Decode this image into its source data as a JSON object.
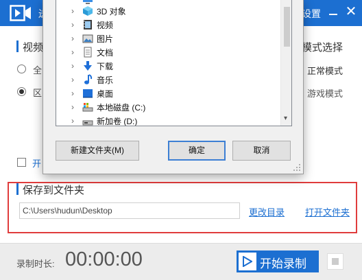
{
  "app": {
    "title_visible": "迸",
    "title_right": "设置",
    "colors": {
      "accent": "#1c6fd1",
      "highlight_border": "#e03c3c",
      "link": "#1c6fd1"
    }
  },
  "video_section": {
    "label": "视频",
    "right_label": "模式选择",
    "options": [
      {
        "label": "全",
        "checked": false,
        "mode": "正常模式"
      },
      {
        "label": "区",
        "checked": true,
        "mode": "游戏模式"
      }
    ]
  },
  "checkbox_option": {
    "label": "开",
    "checked": false
  },
  "save_folder": {
    "label": "保存到文件夹",
    "path": "C:\\Users\\hudun\\Desktop",
    "change_dir_link": "更改目录",
    "open_folder_link": "打开文件夹"
  },
  "footer": {
    "record_time_label": "录制时长:",
    "record_time": "00:00:00",
    "start_button": "开始录制"
  },
  "folder_dialog": {
    "tree_items": [
      {
        "label": "3D 对象",
        "icon": "3d-objects-icon"
      },
      {
        "label": "视频",
        "icon": "video-folder-icon"
      },
      {
        "label": "图片",
        "icon": "pictures-folder-icon"
      },
      {
        "label": "文档",
        "icon": "documents-folder-icon"
      },
      {
        "label": "下载",
        "icon": "downloads-folder-icon"
      },
      {
        "label": "音乐",
        "icon": "music-folder-icon"
      },
      {
        "label": "桌面",
        "icon": "desktop-folder-icon"
      },
      {
        "label": "本地磁盘 (C:)",
        "icon": "local-disk-icon"
      },
      {
        "label": "新加卷 (D:)",
        "icon": "drive-icon"
      }
    ],
    "new_folder_button": "新建文件夹(M)",
    "ok_button": "确定",
    "cancel_button": "取消"
  }
}
